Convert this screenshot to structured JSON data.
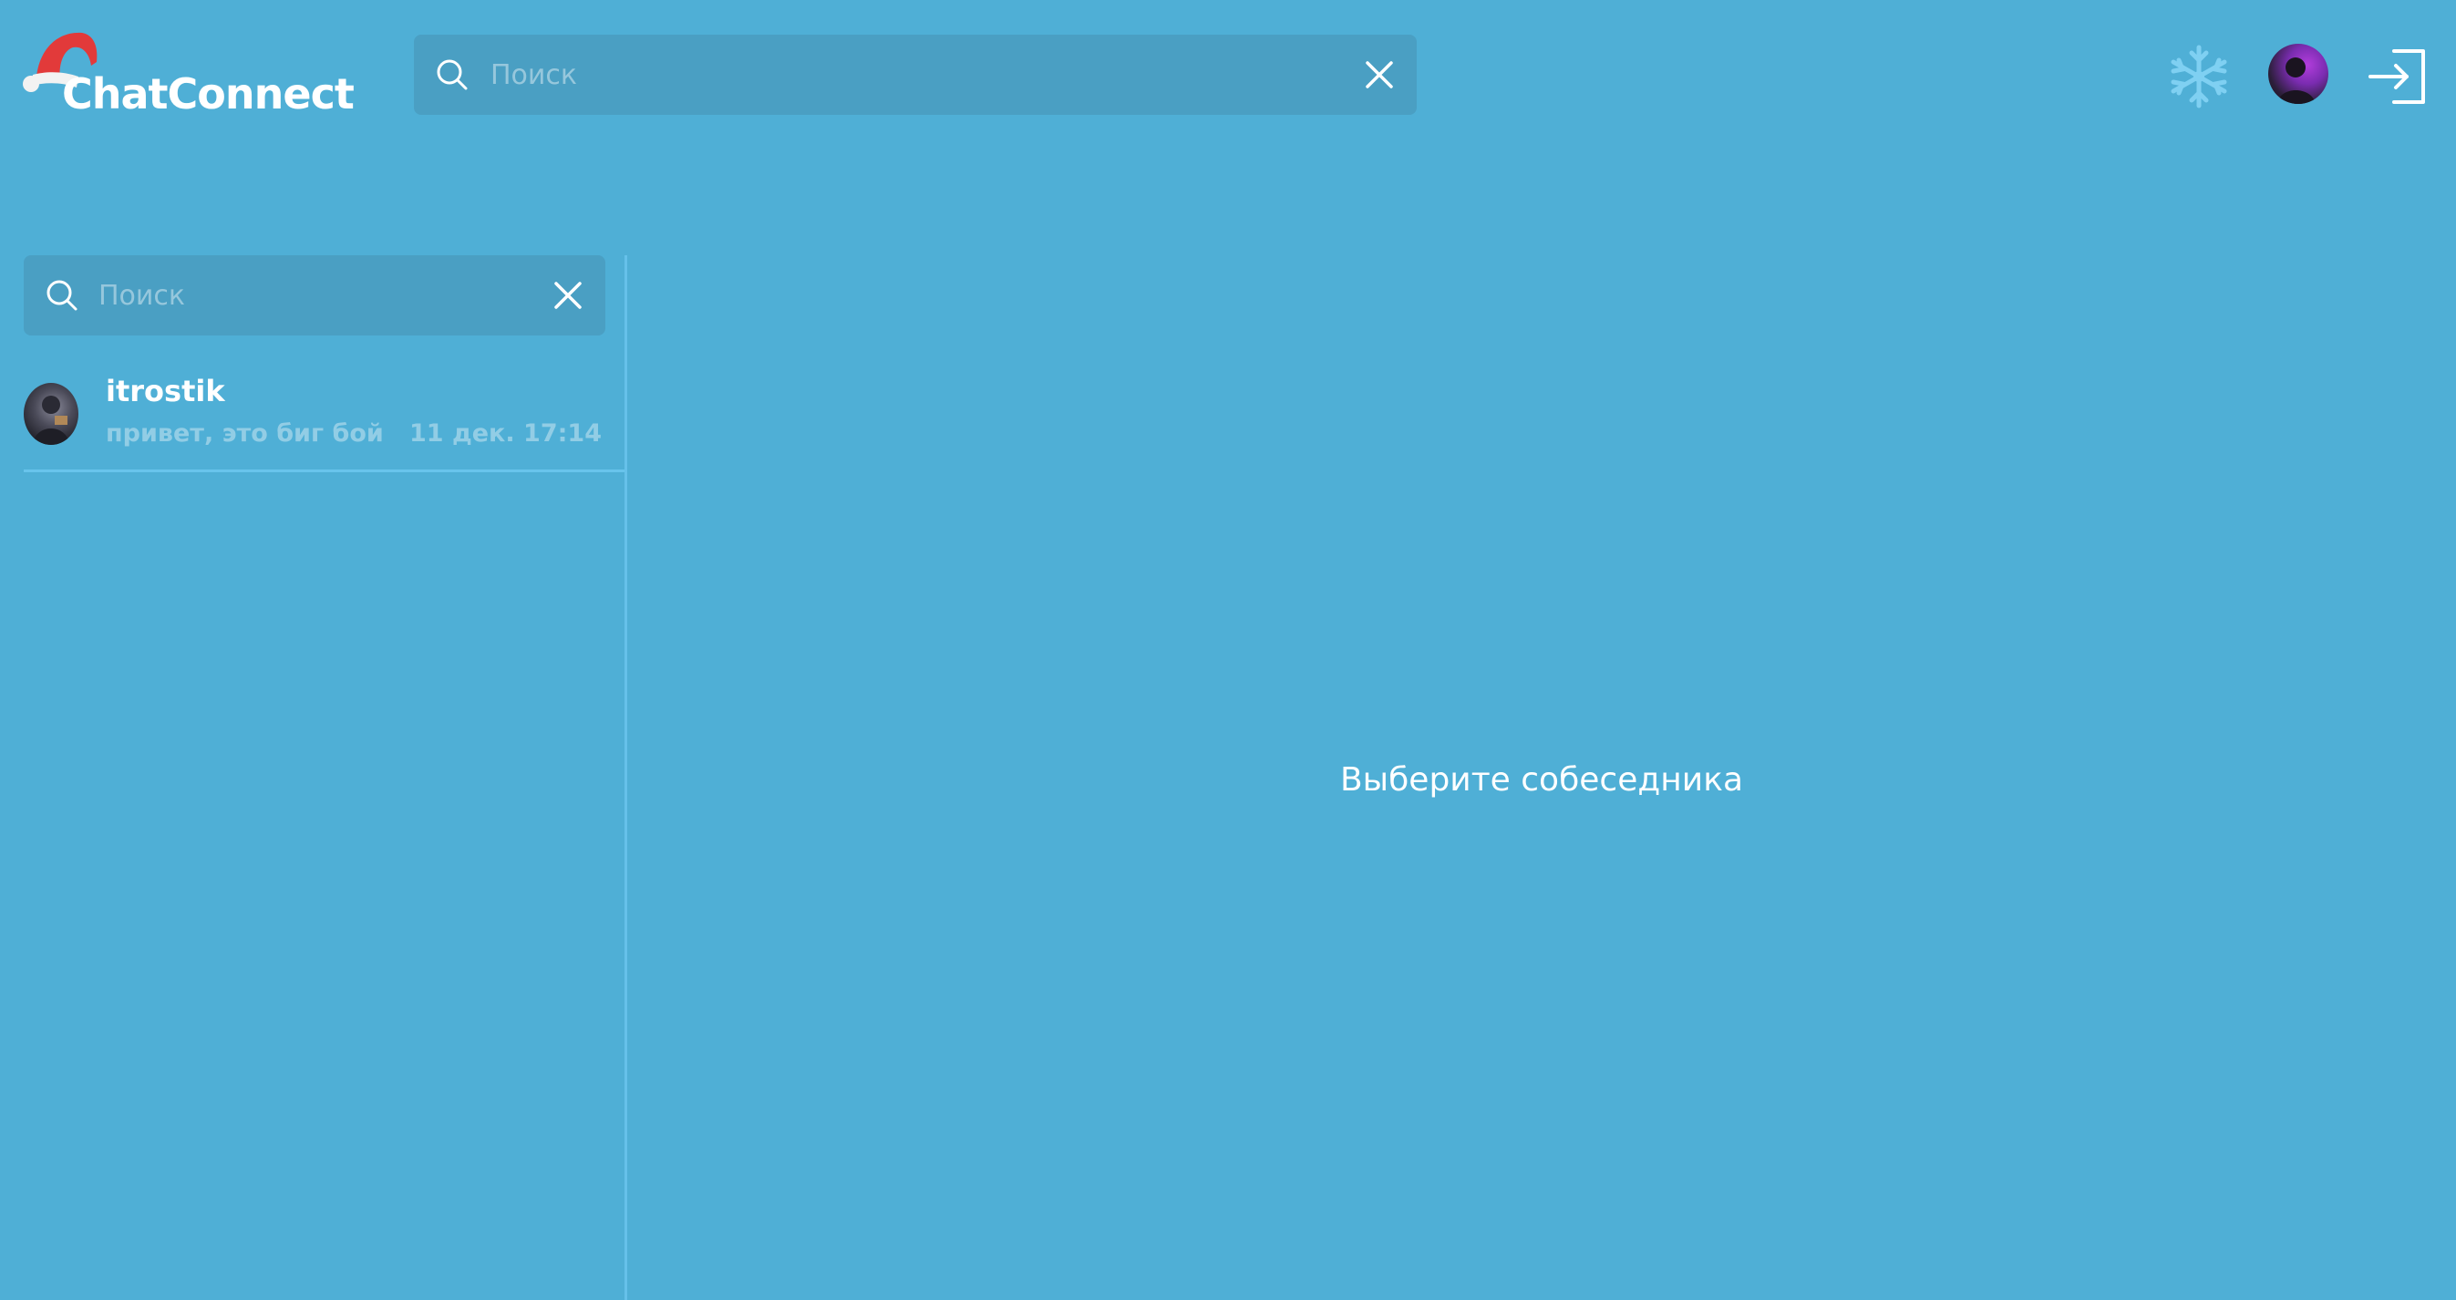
{
  "header": {
    "app_title": "ChatConnect",
    "search": {
      "placeholder": "Поиск",
      "value": ""
    },
    "icons": {
      "logo": "santa-hat-icon",
      "search": "search-icon",
      "clear": "close-icon",
      "theme": "snowflake-icon",
      "avatar": "user-avatar",
      "logout": "logout-icon"
    },
    "snowflake_color": "#7fd0f2"
  },
  "sidebar": {
    "search": {
      "placeholder": "Поиск",
      "value": ""
    },
    "chats": [
      {
        "name": "itrostik",
        "preview": "привет, это биг бой",
        "time": "11 дек. 17:14"
      }
    ]
  },
  "main": {
    "empty_state": "Выберите собеседника"
  },
  "colors": {
    "background": "#4fafd6",
    "search_bg": "#4a9fc3",
    "divider": "#66c1ea",
    "hat_red": "#e23a3a"
  }
}
